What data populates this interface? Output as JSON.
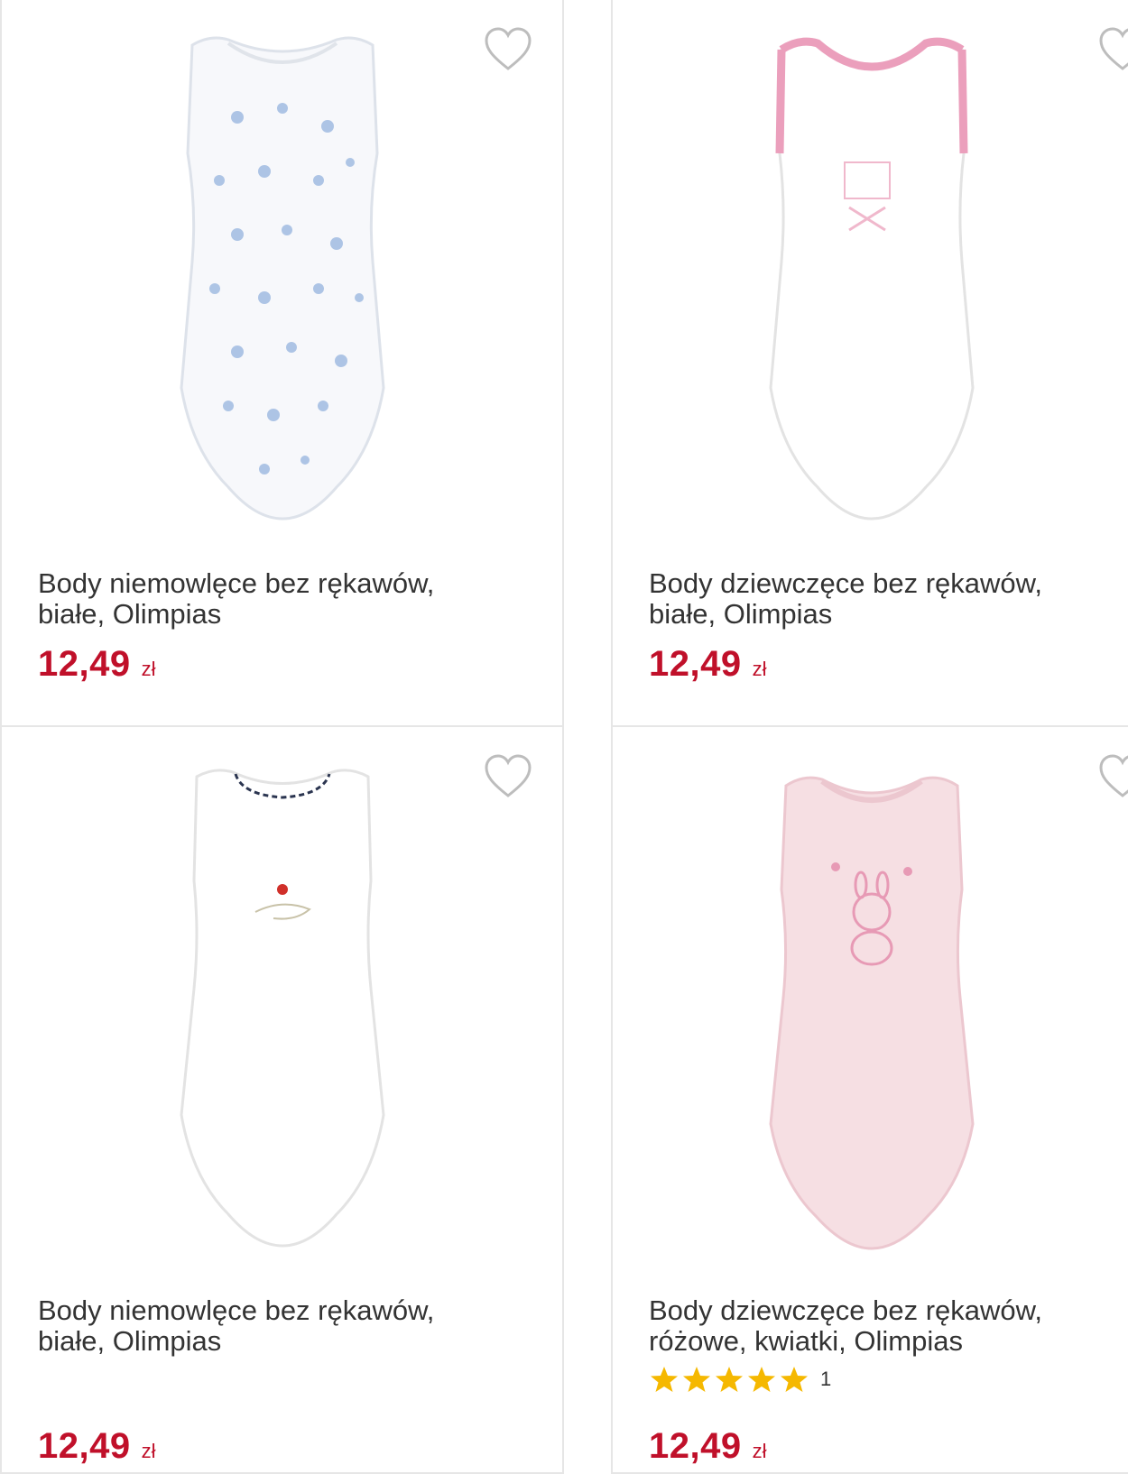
{
  "products": [
    {
      "title_line1": "Body niemowlęce bez rękawów,",
      "title_line2": "białe, Olimpias",
      "price": "12,49",
      "currency": "zł",
      "favorite_icon": "heart-outline-icon",
      "image": "white-sleeveless-bodysuit-blue-print"
    },
    {
      "title_line1": "Body dziewczęce bez rękawów,",
      "title_line2": "białe, Olimpias",
      "price": "12,49",
      "currency": "zł",
      "favorite_icon": "heart-outline-icon",
      "image": "white-sleeveless-bodysuit-pink-trim"
    },
    {
      "title_line1": "Body niemowlęce bez rękawów,",
      "title_line2": "białe, Olimpias",
      "price": "12,49",
      "currency": "zł",
      "favorite_icon": "heart-outline-icon",
      "image": "white-sleeveless-bodysuit-navy-collar"
    },
    {
      "title_line1": "Body dziewczęce bez rękawów,",
      "title_line2": "różowe, kwiatki, Olimpias",
      "rating_stars": 5,
      "rating_count": "1",
      "price": "12,49",
      "currency": "zł",
      "favorite_icon": "heart-outline-icon",
      "image": "pink-sleeveless-bodysuit-bunny"
    }
  ],
  "colors": {
    "price": "#c0102a",
    "star": "#f5b800",
    "border": "#e6e6e6",
    "text": "#333333"
  }
}
